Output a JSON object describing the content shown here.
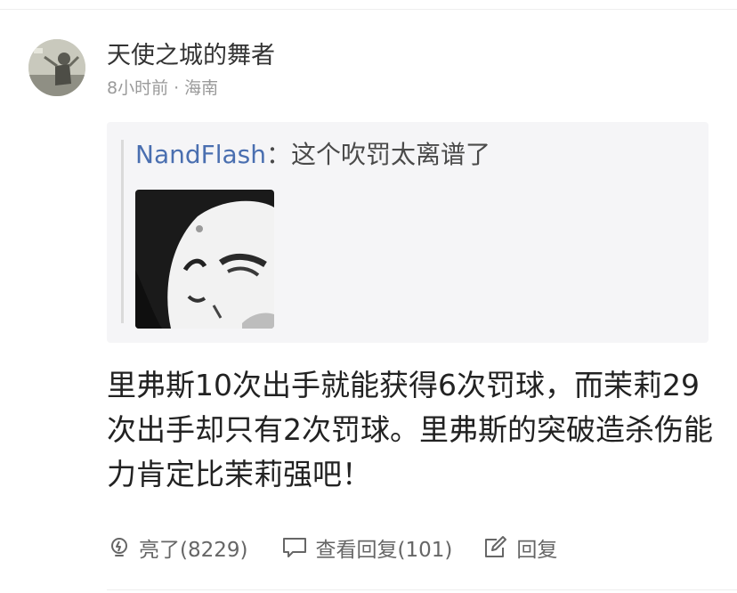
{
  "comment": {
    "username": "天使之城的舞者",
    "time": "8小时前",
    "separator": "·",
    "location": "海南",
    "quote": {
      "author": "NandFlash",
      "colon": "：",
      "text": "这个吹罚太离谱了",
      "image_icon": "meme-face-image"
    },
    "body": "里弗斯10次出手就能获得6次罚球，而茉莉29次出手却只有2次罚球。里弗斯的突破造杀伤能力肯定比茉莉强吧！",
    "actions": {
      "like_label": "亮了(8229)",
      "view_replies_label": "查看回复(101)",
      "reply_label": "回复"
    }
  },
  "colors": {
    "quote_author": "#4a6fb0",
    "quote_background": "#f5f5f7",
    "text_primary": "#222222",
    "text_secondary": "#9a9a9a"
  }
}
